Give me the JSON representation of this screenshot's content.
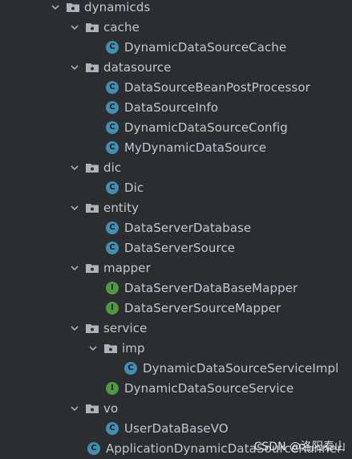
{
  "tree": {
    "root": {
      "label": "dynamicds",
      "icon": "package-folder-icon",
      "expanded": true
    },
    "folders": {
      "cache": "cache",
      "datasource": "datasource",
      "dic": "dic",
      "entity": "entity",
      "mapper": "mapper",
      "service": "service",
      "imp": "imp",
      "vo": "vo"
    },
    "classes": {
      "cache_1": "DynamicDataSourceCache",
      "datasource_1": "DataSourceBeanPostProcessor",
      "datasource_2": "DataSourceInfo",
      "datasource_3": "DynamicDataSourceConfig",
      "datasource_4": "MyDynamicDataSource",
      "dic_1": "Dic",
      "entity_1": "DataServerDatabase",
      "entity_2": "DataServerSource",
      "mapper_1": "DataServerDataBaseMapper",
      "mapper_2": "DataServerSourceMapper",
      "imp_1": "DynamicDataSourceServiceImpl",
      "service_1": "DynamicDataSourceService",
      "vo_1": "UserDataBaseVO",
      "app": "ApplicationDynamicDataSourceRunner"
    },
    "badges": {
      "class": "C",
      "interface": "I"
    }
  },
  "watermark": "CSDN @洛阳泰山",
  "colors": {
    "background": "#2b2d30",
    "text": "#c4c7cc",
    "class_icon": "#3e8fb0",
    "interface_icon": "#4e9a3f"
  }
}
